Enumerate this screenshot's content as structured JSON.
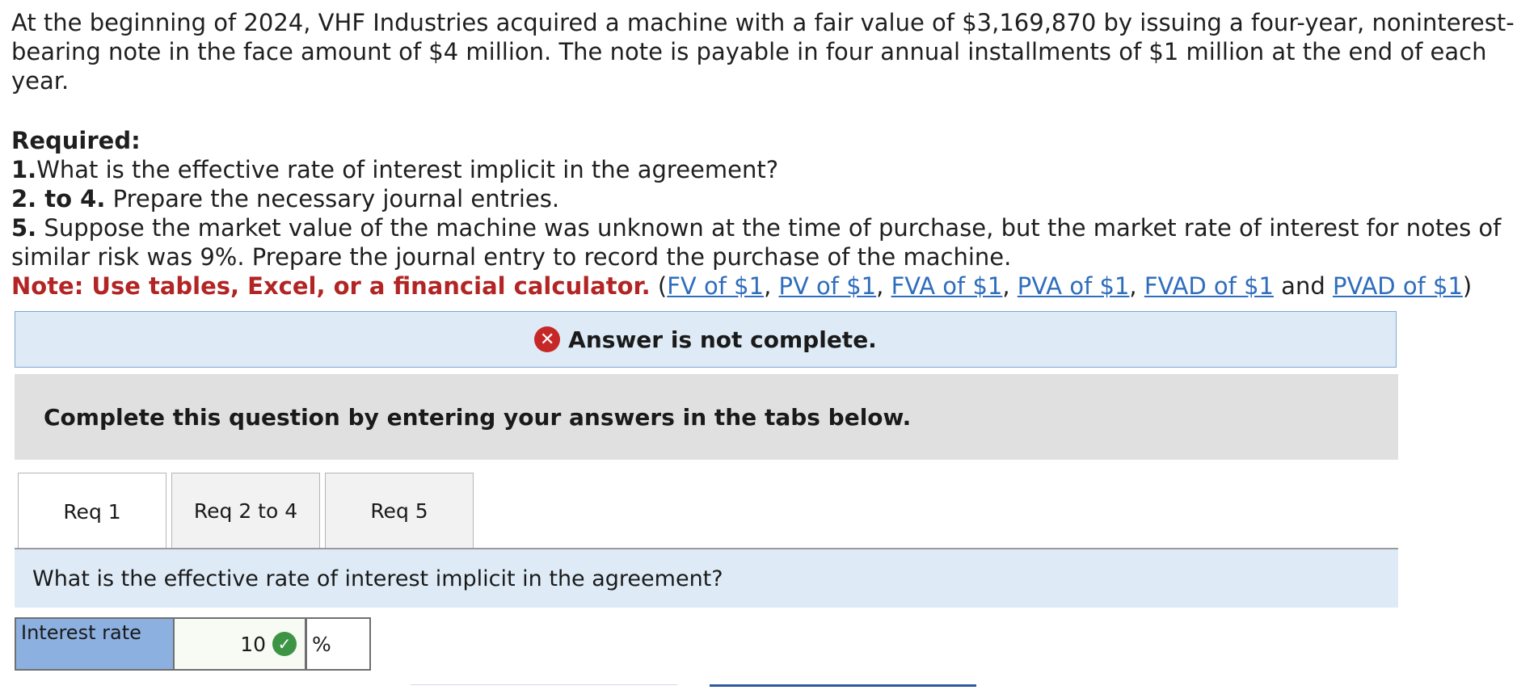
{
  "problem": {
    "intro": "At the beginning of 2024, VHF Industries acquired a machine with a fair value of $3,169,870 by issuing a four-year, noninterest-bearing note in the face amount of $4 million. The note is payable in four annual installments of $1 million at the end of each year.",
    "required_heading": "Required:",
    "req1_num": "1.",
    "req1_text": "What is the effective rate of interest implicit in the agreement?",
    "req2_num": "2. to 4.",
    "req2_text": " Prepare the necessary journal entries.",
    "req5_num": "5.",
    "req5_text": " Suppose the market value of the machine was unknown at the time of purchase, but the market rate of interest for notes of similar risk was 9%. Prepare the journal entry to record the purchase of the machine.",
    "note_label": "Note: Use tables, Excel, or a financial calculator.",
    "note_open": " (",
    "links": [
      "FV of $1",
      "PV of $1",
      "FVA of $1",
      "PVA of $1",
      "FVAD of $1",
      "PVAD of $1"
    ],
    "sep": ", ",
    "and_text": " and ",
    "note_close": ")"
  },
  "banner": {
    "icon": "x-circle-icon",
    "text": "Answer is not complete."
  },
  "instructions": "Complete this question by entering your answers in the tabs below.",
  "tabs": [
    {
      "label": "Req 1",
      "active": true
    },
    {
      "label": "Req 2 to 4",
      "active": false
    },
    {
      "label": "Req 5",
      "active": false
    }
  ],
  "question": "What is the effective rate of interest implicit in the agreement?",
  "answer": {
    "label": "Interest rate",
    "value": "10",
    "status_icon": "check-circle-icon",
    "unit": "%"
  },
  "colors": {
    "error": "#c62828",
    "correct": "#3d9444",
    "link": "#2f6dbd",
    "note": "#b32525",
    "banner_bg": "#deebf7",
    "label_bg": "#8cb0e0"
  }
}
